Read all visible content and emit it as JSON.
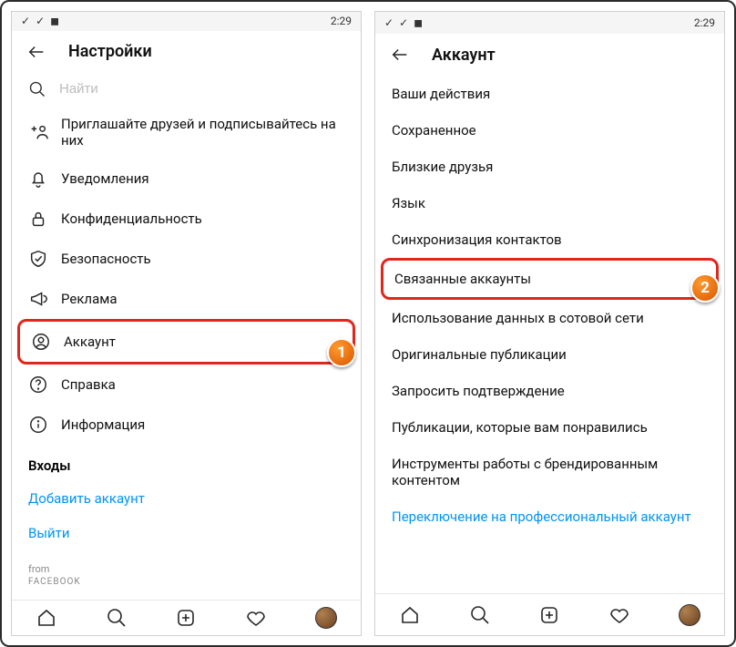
{
  "status": {
    "time": "2:29"
  },
  "left": {
    "title": "Настройки",
    "search_placeholder": "Найти",
    "items": {
      "invite": "Приглашайте друзей и подписывайтесь на них",
      "notifications": "Уведомления",
      "privacy": "Конфиденциальность",
      "security": "Безопасность",
      "ads": "Реклама",
      "account": "Аккаунт",
      "help": "Справка",
      "about": "Информация"
    },
    "logins_label": "Входы",
    "add_account": "Добавить аккаунт",
    "logout": "Выйти",
    "brand_from": "from",
    "brand_name": "FACEBOOK"
  },
  "right": {
    "title": "Аккаунт",
    "items": {
      "activity": "Ваши действия",
      "saved": "Сохраненное",
      "close_friends": "Близкие друзья",
      "language": "Язык",
      "contacts": "Синхронизация контактов",
      "linked": "Связанные аккаунты",
      "data_usage": "Использование данных в сотовой сети",
      "original_posts": "Оригинальные публикации",
      "verify": "Запросить подтверждение",
      "liked": "Публикации, которые вам понравились",
      "branded": "Инструменты работы с брендированным контентом",
      "switch_pro": "Переключение на профессиональный аккаунт"
    }
  },
  "annotations": {
    "badge1": "1",
    "badge2": "2"
  }
}
